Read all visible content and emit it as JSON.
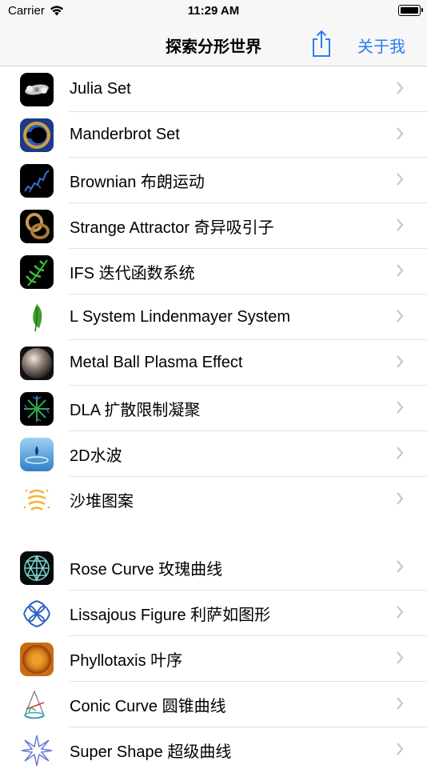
{
  "status": {
    "carrier": "Carrier",
    "time": "11:29 AM"
  },
  "nav": {
    "title": "探索分形世界",
    "about_label": "关于我"
  },
  "section1": [
    {
      "label": "Julia Set",
      "icon": "julia-set-icon"
    },
    {
      "label": "Manderbrot Set",
      "icon": "mandelbrot-icon"
    },
    {
      "label": "Brownian 布朗运动",
      "icon": "brownian-icon"
    },
    {
      "label": "Strange Attractor 奇异吸引子",
      "icon": "attractor-icon"
    },
    {
      "label": "IFS 迭代函数系统",
      "icon": "fern-icon"
    },
    {
      "label": "L System Lindenmayer System",
      "icon": "leaf-icon"
    },
    {
      "label": "Metal Ball Plasma Effect",
      "icon": "metal-ball-icon"
    },
    {
      "label": "DLA 扩散限制凝聚",
      "icon": "dla-icon"
    },
    {
      "label": "2D水波",
      "icon": "water-drop-icon"
    },
    {
      "label": "沙堆图案",
      "icon": "sandpile-icon"
    }
  ],
  "section2": [
    {
      "label": "Rose Curve 玫瑰曲线",
      "icon": "rose-curve-icon"
    },
    {
      "label": "Lissajous Figure 利萨如图形",
      "icon": "lissajous-icon"
    },
    {
      "label": "Phyllotaxis 叶序",
      "icon": "phyllotaxis-icon"
    },
    {
      "label": "Conic Curve 圆锥曲线",
      "icon": "conic-icon"
    },
    {
      "label": "Super Shape 超级曲线",
      "icon": "super-shape-icon"
    }
  ]
}
